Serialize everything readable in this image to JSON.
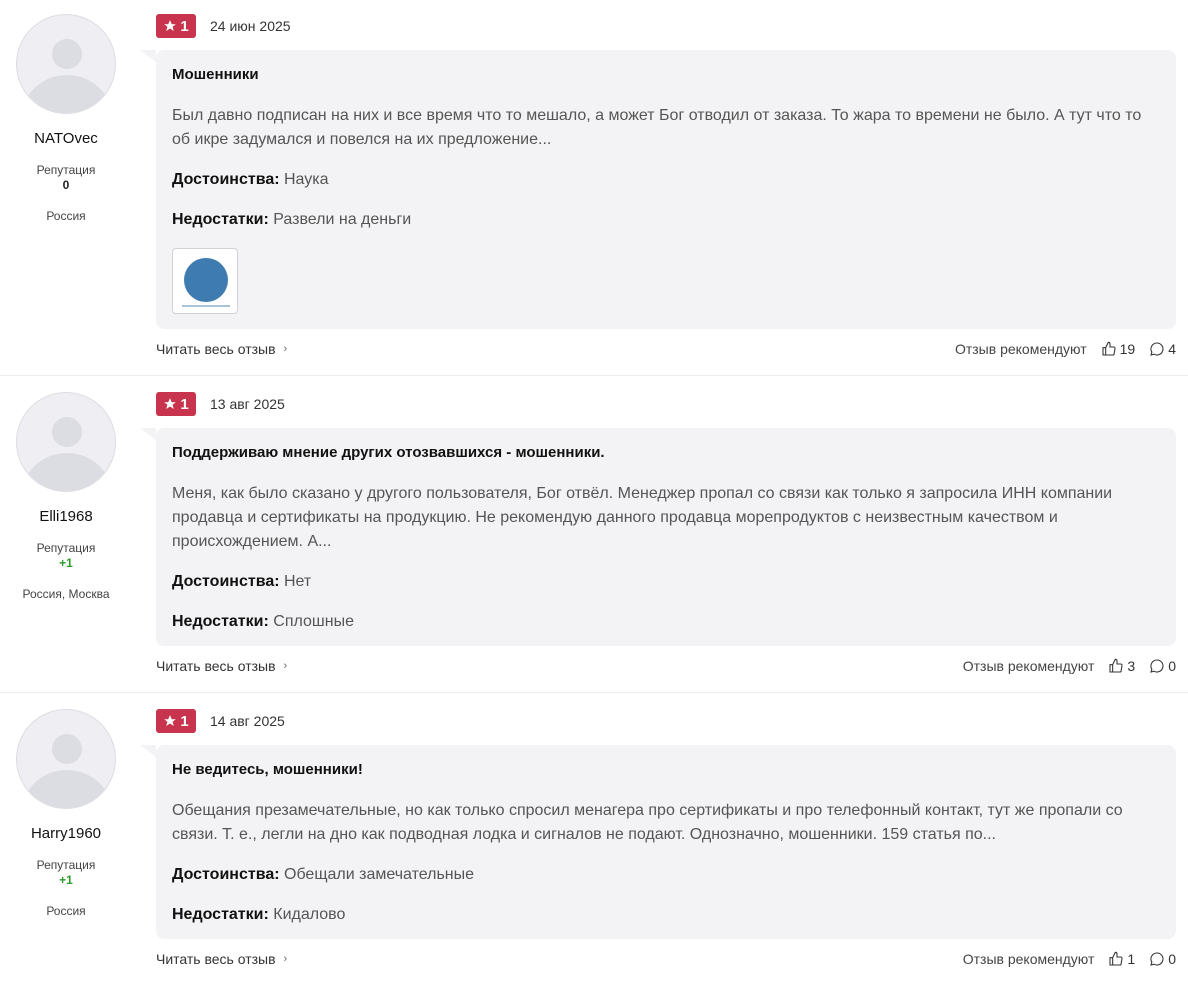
{
  "labels": {
    "reputation": "Репутация",
    "pros": "Достоинства:",
    "cons": "Недостатки:",
    "read_more": "Читать весь отзыв",
    "recommend": "Отзыв рекомендуют"
  },
  "reviews": [
    {
      "user": "NATOvec",
      "reputation": "0",
      "location": "Россия",
      "rating": "1",
      "date": "24 июн 2025",
      "title": "Мошенники",
      "text": "Был давно подписан на них и все время что то мешало, а может Бог отводил от заказа. То жара то времени не было. А тут что то об икре задумался и повелся на их предложение...",
      "pros": "Наука",
      "cons": "Развели на деньги",
      "likes": "19",
      "comments": "4"
    },
    {
      "user": "Elli1968",
      "reputation": "+1",
      "location": "Россия, Москва",
      "rating": "1",
      "date": "13 авг 2025",
      "title": "Поддерживаю мнение других отозвавшихся - мошенники.",
      "text": "Меня, как было сказано у другого пользователя, Бог отвёл. Менеджер пропал со связи как только я запросила ИНН компании продавца и сертификаты на продукцию. Не рекомендую данного продавца морепродуктов с неизвестным качеством и происхождением. А...",
      "pros": "Нет",
      "cons": "Сплошные",
      "likes": "3",
      "comments": "0"
    },
    {
      "user": "Harry1960",
      "reputation": "+1",
      "location": "Россия",
      "rating": "1",
      "date": "14 авг 2025",
      "title": "Не ведитесь, мошенники!",
      "text": "Обещания презамечательные, но как только спросил менагера про сертификаты и про телефонный контакт, тут же пропали со связи. Т. е., легли на дно как подводная лодка и сигналов не подают. Однозначно, мошенники. 159 статья по...",
      "pros": "Обещали замечательные",
      "cons": "Кидалово",
      "likes": "1",
      "comments": "0"
    }
  ]
}
